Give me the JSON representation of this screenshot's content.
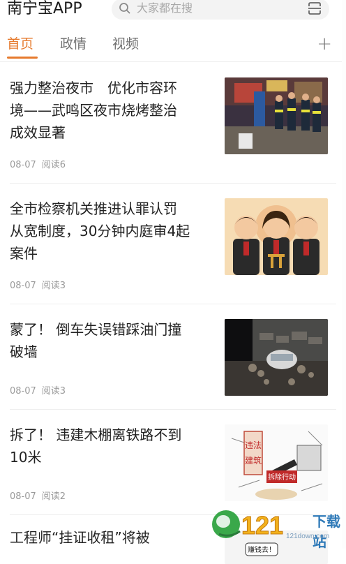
{
  "header": {
    "app_title": "南宁宝APP",
    "search_placeholder": "大家都在搜"
  },
  "tabs": [
    {
      "label": "首页",
      "active": true
    },
    {
      "label": "政情",
      "active": false
    },
    {
      "label": "视频",
      "active": false
    }
  ],
  "add_tab_label": "+",
  "news": [
    {
      "title_lines": [
        "强力整治夜市　优化市容环",
        "境——武鸣区夜市烧烤整治",
        "成效显著"
      ],
      "date": "08-07",
      "reads": "阅读6",
      "thumb": "street-night-patrol"
    },
    {
      "title_lines": [
        "全市检察机关推进认罪认罚",
        "从宽制度，30分钟内庭审4起",
        "案件"
      ],
      "date": "08-07",
      "reads": "阅读3",
      "thumb": "prosecutors-cartoon"
    },
    {
      "title_lines": [
        "蒙了！ 倒车失误错踩油门撞",
        "破墙"
      ],
      "date": "08-07",
      "reads": "阅读3",
      "thumb": "car-crash-wall"
    },
    {
      "title_lines": [
        "拆了！ 违建木棚离铁路不到",
        "10米"
      ],
      "date": "08-07",
      "reads": "阅读2",
      "thumb": "demolition-cartoon"
    },
    {
      "title_lines": [
        "工程师“挂证收租”将被"
      ],
      "thumb": "partial-cartoon"
    }
  ],
  "thumb_texts": {
    "demolition_tags": [
      "违法",
      "建筑"
    ],
    "demolition_sign": "拆除行动",
    "partial_bubble": "赚钱去！"
  },
  "watermark": {
    "brand": "121下载站",
    "site": "121down.com"
  },
  "colors": {
    "accent": "#e67a2d",
    "text_primary": "#222222",
    "text_secondary": "#9a9a9a"
  }
}
